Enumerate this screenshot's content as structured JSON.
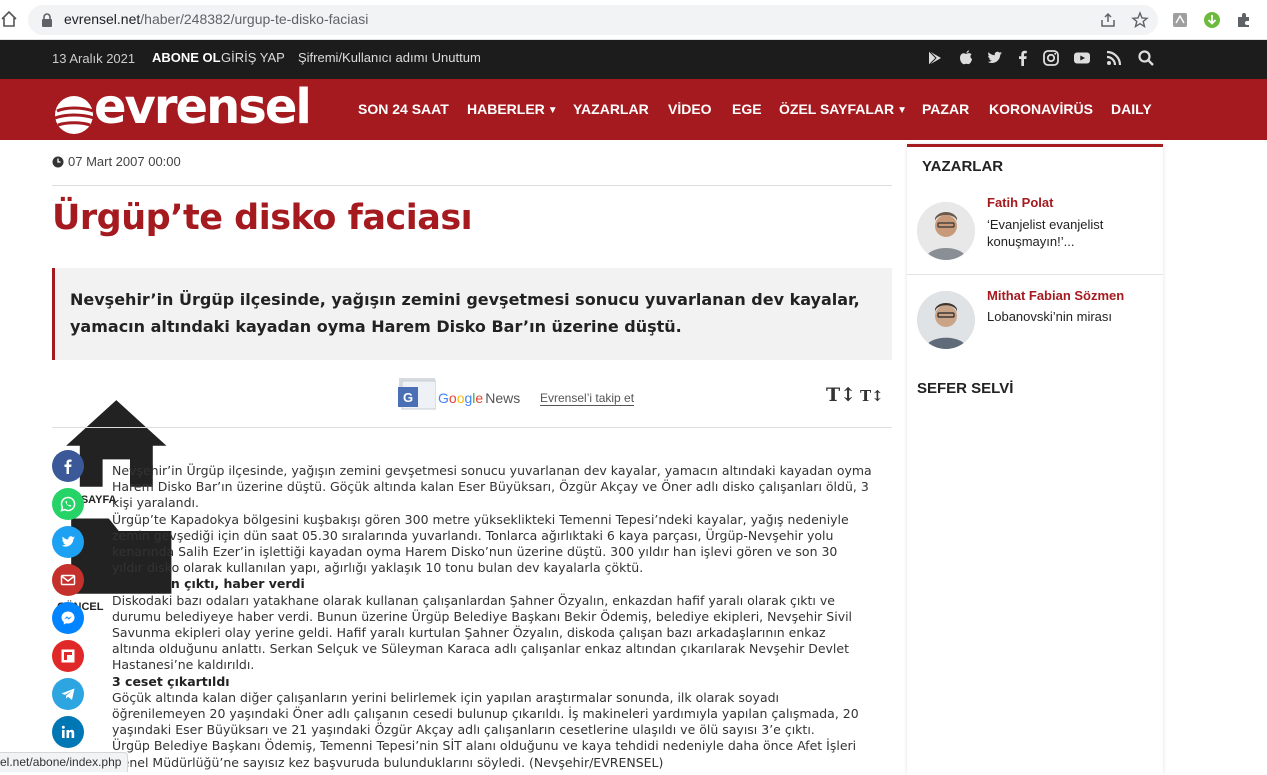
{
  "browser": {
    "url_host": "evrensel.net",
    "url_path": "/haber/248382/urgup-te-disko-faciasi"
  },
  "topbar": {
    "date": "13 Aralık 2021",
    "abone": "ABONE OL",
    "giris": "GİRİŞ YAP",
    "sifre": "Şifremi/Kullanıcı adımı Unuttum"
  },
  "logo": {
    "text": "evrensel"
  },
  "nav": {
    "items": [
      "SON 24 SAAT",
      "HABERLER",
      "YAZARLAR",
      "VİDEO",
      "EGE",
      "ÖZEL SAYFALAR",
      "PAZAR",
      "KORONAVİRÜS",
      "DAILY"
    ]
  },
  "article": {
    "datetime": "07 Mart 2007 00:00",
    "title": "Ürgüp’te disko faciası",
    "spot_line1": "Nevşehir’in Ürgüp ilçesinde, yağışın zemini gevşetmesi sonucu yuvarlanan dev kayalar,",
    "spot_line2": "yamacın altındaki kayadan oyma Harem Disko Bar’ın üzerine düştü.",
    "crumb_home": "ANASAYFA",
    "crumb_cat": "GÜNCEL",
    "gnews_follow": "Evrensel’i takip et",
    "gnews_news": "News",
    "font_big": "T↕",
    "font_small": "T↕",
    "p1": "Nevşehir’in Ürgüp ilçesinde, yağışın zemini gevşetmesi sonucu yuvarlanan dev kayalar, yamacın altındaki kayadan oyma Harem Disko Bar’ın üzerine düştü. Göçük altında kalan Eser Büyüksarı, Özgür Akçay ve Öner adlı disko çalışanları öldü, 3 kişi yaralandı.",
    "p2": "Ürgüp’te Kapadokya bölgesini kuşbakışı gören 300 metre yükseklikteki Temenni Tepesi’ndeki kayalar, yağış nedeniyle zemin gevşediği için dün saat 05.30 sıralarında yuvarlandı. Tonlarca ağırlıktaki 6 kaya parçası, Ürgüp-Nevşehir yolu kenarında Salih Ezer’in işlettiği kayadan oyma Harem Disko’nun üzerine düştü. 300 yıldır han işlevi gören ve son 30 yıldır disko olarak kullanılan yapı, ağırlığı yaklaşık 10 tonu bulan dev kayalarla çöktü.",
    "h1": "Enkazdan çıktı, haber verdi",
    "p3": "Diskodaki bazı odaları yatakhane olarak kullanan çalışanlardan Şahner Özyalın, enkazdan hafif yaralı olarak çıktı ve durumu belediyeye haber verdi. Bunun üzerine Ürgüp Belediye Başkanı Bekir Ödemiş, belediye ekipleri, Nevşehir Sivil Savunma ekipleri olay yerine geldi. Hafif yaralı kurtulan Şahner Özyalın, diskoda çalışan bazı arkadaşlarının enkaz altında olduğunu anlattı. Serkan Selçuk ve Süleyman Karaca adlı çalışanlar enkaz altından çıkarılarak Nevşehir Devlet Hastanesi’ne kaldırıldı.",
    "h2": "3 ceset çıkartıldı",
    "p4": "Göçük altında kalan diğer çalışanların yerini belirlemek için yapılan araştırmalar sonunda, ilk olarak soyadı öğrenilemeyen 20 yaşındaki Öner adlı çalışanın cesedi bulunup çıkarıldı. İş makineleri yardımıyla yapılan çalışmada, 20 yaşındaki Eser Büyüksarı ve 21 yaşındaki Özgür Akçay adlı çalışanların cesetlerine ulaşıldı ve ölü sayısı 3’e çıktı.",
    "p5": "Ürgüp Belediye Başkanı Ödemiş, Temenni Tepesi’nin SİT alanı olduğunu ve kaya tehdidi nedeniyle daha önce Afet İşleri Genel Müdürlüğü’ne sayısız kez başvuruda bulunduklarını söyledi. (Nevşehir/EVRENSEL)"
  },
  "share": [
    {
      "name": "facebook",
      "color": "#3b5998"
    },
    {
      "name": "whatsapp",
      "color": "#25d366"
    },
    {
      "name": "twitter",
      "color": "#1da1f2"
    },
    {
      "name": "email",
      "color": "#c4302b"
    },
    {
      "name": "messenger",
      "color": "#0084ff"
    },
    {
      "name": "flipboard",
      "color": "#e12828"
    },
    {
      "name": "telegram",
      "color": "#2ca5e0"
    },
    {
      "name": "linkedin",
      "color": "#0077b5"
    }
  ],
  "sidebar": {
    "heading": "YAZARLAR",
    "authors": [
      {
        "name": "Fatih Polat",
        "article": "‘Evanjelist evanjelist konuşmayın!’..."
      },
      {
        "name": "Mithat Fabian Sözmen",
        "article": "Lobanovski’nin mirası"
      }
    ],
    "sefer": "SEFER SELVİ"
  },
  "status": {
    "text": "el.net/abone/index.php"
  },
  "colors": {
    "brand": "#a51a1f",
    "topbar": "#1c1c1c"
  }
}
